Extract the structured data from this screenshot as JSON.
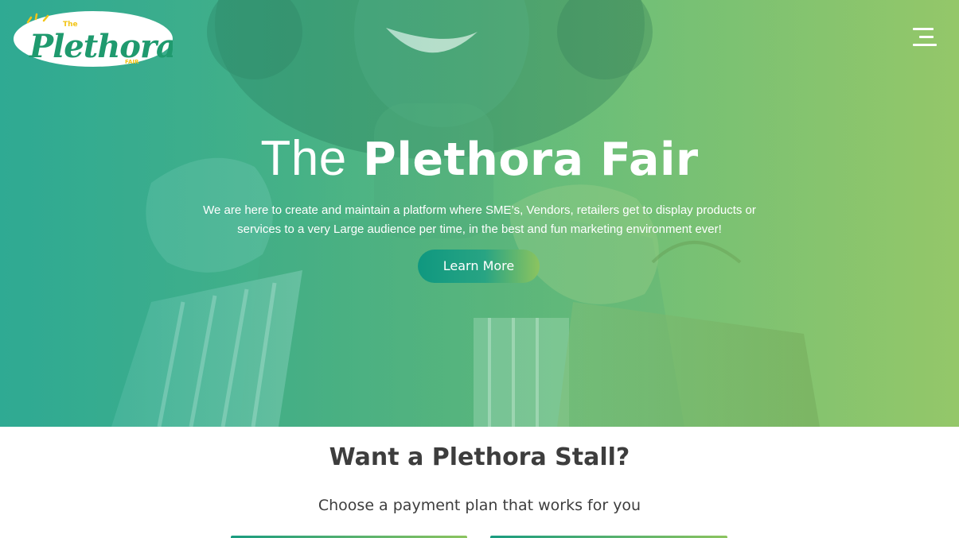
{
  "header": {
    "logo": {
      "text_top": "The",
      "text_main": "Plethora",
      "text_sub": "FAIR"
    },
    "menu_icon": "hamburger-menu-icon"
  },
  "hero": {
    "title_light": "The",
    "title_bold": "Plethora Fair",
    "description": "We are here to create and maintain a platform where SME’s, Vendors, retailers get to display products or services to a very Large audience per time, in the best and fun marketing environment ever!",
    "cta_label": "Learn More"
  },
  "stall_section": {
    "title": "Want a Plethora Stall?",
    "subtitle": "Choose a payment plan that works for you"
  },
  "colors": {
    "brand_green": "#1f9a6e",
    "accent_yellow": "#f2c416",
    "hero_gradient_start": "#37a98f",
    "hero_gradient_end": "#92c66d",
    "text_dark": "#3d3d3d"
  }
}
